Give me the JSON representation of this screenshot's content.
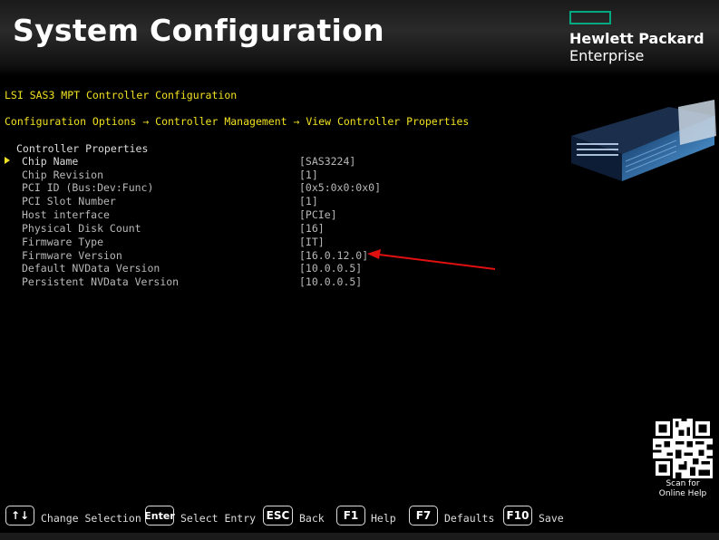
{
  "header": {
    "title": "System Configuration",
    "brand_line1": "Hewlett Packard",
    "brand_line2": "Enterprise"
  },
  "breadcrumb": {
    "title": "LSI SAS3 MPT Controller Configuration",
    "path": "Configuration Options → Controller Management → View Controller Properties"
  },
  "properties": {
    "heading": "Controller Properties",
    "rows": [
      {
        "label": "Chip Name",
        "value": "[SAS3224]"
      },
      {
        "label": "Chip Revision",
        "value": "[1]"
      },
      {
        "label": "PCI ID (Bus:Dev:Func)",
        "value": "[0x5:0x0:0x0]"
      },
      {
        "label": "PCI Slot Number",
        "value": "[1]"
      },
      {
        "label": "Host interface",
        "value": "[PCIe]"
      },
      {
        "label": "Physical Disk Count",
        "value": "[16]"
      },
      {
        "label": "Firmware Type",
        "value": "[IT]"
      },
      {
        "label": "Firmware Version",
        "value": "[16.0.12.0]"
      },
      {
        "label": "Default NVData Version",
        "value": "[10.0.0.5]"
      },
      {
        "label": "Persistent NVData Version",
        "value": "[10.0.0.5]"
      }
    ]
  },
  "qr": {
    "caption_line1": "Scan for",
    "caption_line2": "Online Help"
  },
  "footer": {
    "keys": [
      {
        "key": "↑↓",
        "label": "Change Selection"
      },
      {
        "key": "Enter",
        "label": "Select Entry"
      },
      {
        "key": "ESC",
        "label": "Back"
      },
      {
        "key": "F1",
        "label": "Help"
      },
      {
        "key": "F7",
        "label": "Defaults"
      },
      {
        "key": "F10",
        "label": "Save"
      }
    ]
  },
  "colors": {
    "accent": "#01a982",
    "highlight": "#f0e020",
    "annotation_arrow": "#e01010"
  }
}
